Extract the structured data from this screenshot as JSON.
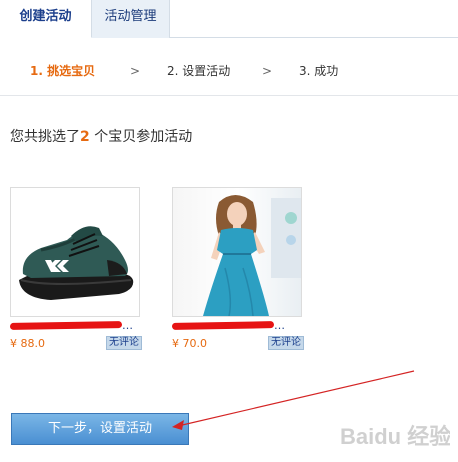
{
  "tabs": [
    {
      "label": "创建活动",
      "active": true
    },
    {
      "label": "活动管理",
      "active": false
    }
  ],
  "steps": {
    "step1": "1. 挑选宝贝",
    "sep": ">",
    "step2": "2. 设置活动",
    "step3": "3. 成功"
  },
  "summary": {
    "prefix": "您共挑选了",
    "count": "2",
    "suffix": "个宝贝参加活动"
  },
  "products": [
    {
      "title": "…",
      "price": "¥ 88.0",
      "badge": "无评论",
      "image_icon": "shoe-image"
    },
    {
      "title": "…",
      "price": "¥ 70.0",
      "badge": "无评论",
      "image_icon": "dress-image"
    }
  ],
  "next_button": "下一步，设置活动",
  "watermark": "Baidu 经验",
  "colors": {
    "accent": "#e66a11",
    "link": "#1c3f8c",
    "button": "#4a8fd2",
    "redact": "#e61414"
  }
}
